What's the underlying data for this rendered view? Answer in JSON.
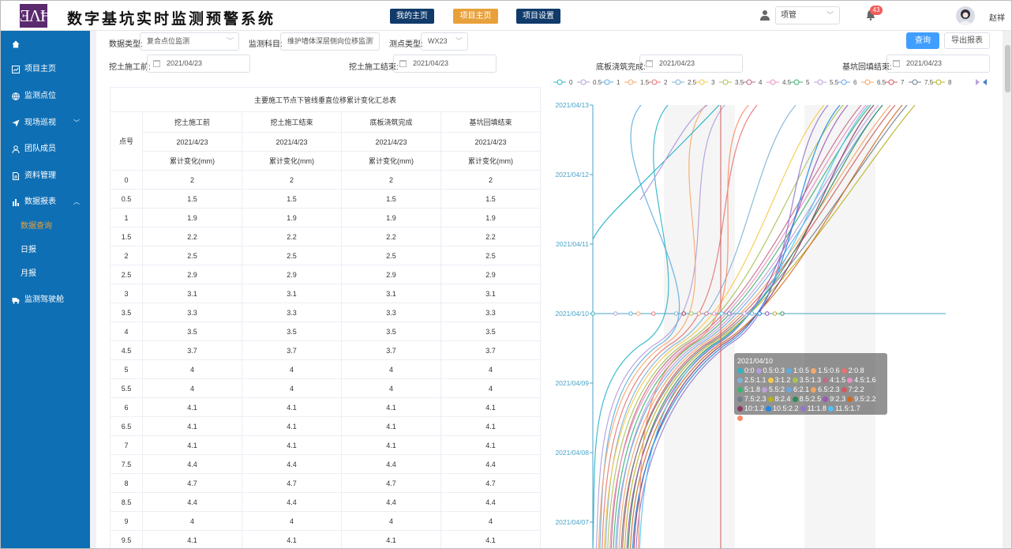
{
  "header": {
    "logo_text": "ƎΛĦ",
    "title": "数字基坑实时监测预警系统",
    "nav": [
      {
        "label": "我的主页",
        "color": "#0f3a6a"
      },
      {
        "label": "项目主页",
        "color": "#e8a13a"
      },
      {
        "label": "项目设置",
        "color": "#0f3a6a"
      }
    ],
    "role_select": "项管",
    "notification_count": "43",
    "user_name": "赵祥"
  },
  "sidebar": {
    "items": [
      {
        "label": "",
        "icon": "home-icon"
      },
      {
        "label": "项目主页",
        "icon": "chart-icon"
      },
      {
        "label": "监测点位",
        "icon": "globe-icon"
      },
      {
        "label": "现场巡视",
        "icon": "send-icon"
      },
      {
        "label": "团队成员",
        "icon": "user-icon"
      },
      {
        "label": "资料管理",
        "icon": "file-icon"
      },
      {
        "label": "数据报表",
        "icon": "bar-chart-icon"
      }
    ],
    "sub_items": [
      "数据查询",
      "日报",
      "月报"
    ],
    "extra_item": {
      "label": "监测驾驶舱",
      "icon": "truck-icon"
    },
    "active_sub_color": "#e8a13a"
  },
  "filters": {
    "data_type_label": "数据类型:",
    "data_type_value": "复合点位监测",
    "subject_label": "监测科目:",
    "subject_value": "维护墙体深层侧向位移监测",
    "point_type_label": "测点类型:",
    "point_type_value": "WX23",
    "query_button": "查询",
    "export_button": "导出报表",
    "dates": [
      {
        "label": "挖土施工前:",
        "value": "2021/04/23"
      },
      {
        "label": "挖土施工结束:",
        "value": "2021/04/23"
      },
      {
        "label": "底板浇筑完成:",
        "value": "2021/04/23"
      },
      {
        "label": "基坑回填结束:",
        "value": "2021/04/23"
      }
    ]
  },
  "table": {
    "caption": "主要施工节点下管线垂直位移累计变化汇总表",
    "point_header": "点号",
    "stage_headers": [
      "挖土施工前",
      "挖土施工结束",
      "底板浇筑完成",
      "基坑回填结束"
    ],
    "stage_dates": [
      "2021/4/23",
      "2021/4/23",
      "2021/4/23",
      "2021/4/23"
    ],
    "unit_header": "累计变化(mm)",
    "rows": [
      {
        "point": "0",
        "values": [
          "2",
          "2",
          "2",
          "2"
        ]
      },
      {
        "point": "0.5",
        "values": [
          "1.5",
          "1.5",
          "1.5",
          "1.5"
        ]
      },
      {
        "point": "1",
        "values": [
          "1.9",
          "1.9",
          "1.9",
          "1.9"
        ]
      },
      {
        "point": "1.5",
        "values": [
          "2.2",
          "2.2",
          "2.2",
          "2.2"
        ]
      },
      {
        "point": "2",
        "values": [
          "2.5",
          "2.5",
          "2.5",
          "2.5"
        ]
      },
      {
        "point": "2.5",
        "values": [
          "2.9",
          "2.9",
          "2.9",
          "2.9"
        ]
      },
      {
        "point": "3",
        "values": [
          "3.1",
          "3.1",
          "3.1",
          "3.1"
        ]
      },
      {
        "point": "3.5",
        "values": [
          "3.3",
          "3.3",
          "3.3",
          "3.3"
        ]
      },
      {
        "point": "4",
        "values": [
          "3.5",
          "3.5",
          "3.5",
          "3.5"
        ]
      },
      {
        "point": "4.5",
        "values": [
          "3.7",
          "3.7",
          "3.7",
          "3.7"
        ]
      },
      {
        "point": "5",
        "values": [
          "4",
          "4",
          "4",
          "4"
        ]
      },
      {
        "point": "5.5",
        "values": [
          "4",
          "4",
          "4",
          "4"
        ]
      },
      {
        "point": "6",
        "values": [
          "4.1",
          "4.1",
          "4.1",
          "4.1"
        ]
      },
      {
        "point": "6.5",
        "values": [
          "4.1",
          "4.1",
          "4.1",
          "4.1"
        ]
      },
      {
        "point": "7",
        "values": [
          "4.1",
          "4.1",
          "4.1",
          "4.1"
        ]
      },
      {
        "point": "7.5",
        "values": [
          "4.4",
          "4.4",
          "4.4",
          "4.4"
        ]
      },
      {
        "point": "8",
        "values": [
          "4.7",
          "4.7",
          "4.7",
          "4.7"
        ]
      },
      {
        "point": "8.5",
        "values": [
          "4.4",
          "4.4",
          "4.4",
          "4.4"
        ]
      },
      {
        "point": "9",
        "values": [
          "4",
          "4",
          "4",
          "4"
        ]
      },
      {
        "point": "9.5",
        "values": [
          "4.1",
          "4.1",
          "4.1",
          "4.1"
        ]
      }
    ]
  },
  "chart_data": {
    "type": "line",
    "legend_position": "top",
    "legend": [
      "0",
      "0.5",
      "1",
      "1.5",
      "2",
      "2.5",
      "3",
      "3.5",
      "4",
      "4.5",
      "5",
      "5.5",
      "6",
      "6.5",
      "7",
      "7.5",
      "8"
    ],
    "y_ticks": [
      "2021/04/13",
      "2021/04/12",
      "2021/04/11",
      "2021/04/10",
      "2021/04/09",
      "2021/04/08",
      "2021/04/07"
    ],
    "y_axis_direction": "dates increase upward",
    "grid": "alternating vertical bands",
    "crosshair_date": "2021/04/10",
    "colors": [
      "#2bb5c8",
      "#b39ddb",
      "#5dade2",
      "#f6a96b",
      "#e57373",
      "#7fb3d5",
      "#f7c948",
      "#a8c256",
      "#c06c84",
      "#e991c1",
      "#3cb371",
      "#c0a0d8",
      "#6aa8e0",
      "#f4a460",
      "#cd5c5c",
      "#708090",
      "#b8b020",
      "#2e8b57",
      "#9b59b6",
      "#d2691e",
      "#8b3a62",
      "#1e88e5",
      "#9575cd",
      "#4fc3f7",
      "#ff8a65",
      "#ef5350"
    ],
    "tooltip": {
      "date": "2021/04/10",
      "items": [
        {
          "name": "0",
          "value": 0
        },
        {
          "name": "0.5",
          "value": 0.3
        },
        {
          "name": "1",
          "value": 0.5
        },
        {
          "name": "1.5",
          "value": 0.6
        },
        {
          "name": "2",
          "value": 0.8
        },
        {
          "name": "2.5",
          "value": 1.1
        },
        {
          "name": "3",
          "value": 1.2
        },
        {
          "name": "3.5",
          "value": 1.3
        },
        {
          "name": "4",
          "value": 1.5
        },
        {
          "name": "4.5",
          "value": 1.6
        },
        {
          "name": "5",
          "value": 1.8
        },
        {
          "name": "5.5",
          "value": 2
        },
        {
          "name": "6",
          "value": 2.1
        },
        {
          "name": "6.5",
          "value": 2.3
        },
        {
          "name": "7",
          "value": 2.2
        },
        {
          "name": "7.5",
          "value": 2.3
        },
        {
          "name": "8",
          "value": 2.4
        },
        {
          "name": "8.5",
          "value": 2.5
        },
        {
          "name": "9",
          "value": 2.3
        },
        {
          "name": "9.5",
          "value": 2.2
        },
        {
          "name": "10",
          "value": 1.2
        },
        {
          "name": "10.5",
          "value": 2.2
        },
        {
          "name": "11",
          "value": 1.8
        },
        {
          "name": "11.5",
          "value": 1.7
        },
        {
          "name": "12",
          "value": 1.4
        }
      ]
    }
  }
}
